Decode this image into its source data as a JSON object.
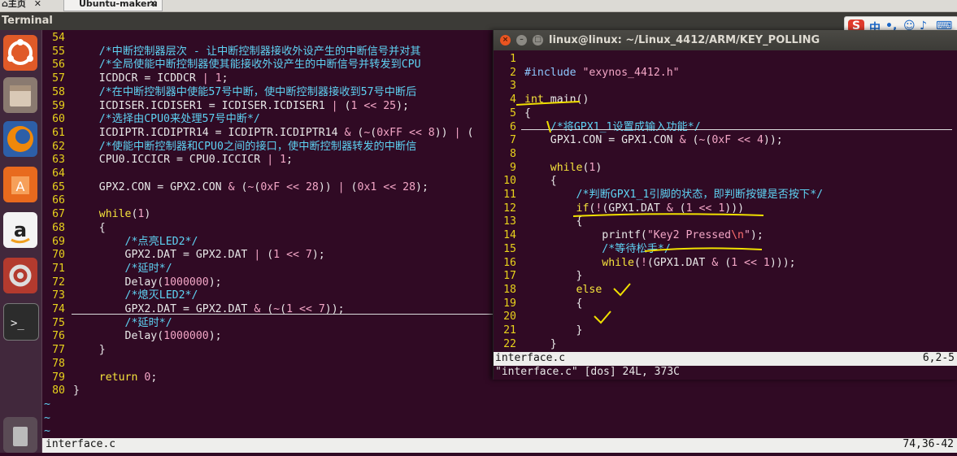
{
  "browser_tabs": {
    "home_label": "主页",
    "home_close": "✕",
    "doc_label": "Ubuntu-makeru",
    "doc_close": "✕"
  },
  "window": {
    "app_title": "Terminal"
  },
  "launcher": {
    "items": [
      "ubuntu-dash",
      "files",
      "firefox",
      "software-center",
      "amazon",
      "system-settings",
      "terminal",
      "trash"
    ]
  },
  "editor": {
    "lines": [
      {
        "n": "54",
        "t": ""
      },
      {
        "n": "55",
        "t": "    /*中断控制器层次 - 让中断控制器接收外设产生的中断信号并对其"
      },
      {
        "n": "56",
        "t": "    /*全局使能中断控制器使其能接收外设产生的中断信号并转发到CPU"
      },
      {
        "n": "57",
        "t": "    ICDDCR = ICDDCR | 1;"
      },
      {
        "n": "58",
        "t": "    /*在中断控制器中使能57号中断，使中断控制器接收到57号中断后"
      },
      {
        "n": "59",
        "t": "    ICDISER.ICDISER1 = ICDISER.ICDISER1 | (1 << 25);"
      },
      {
        "n": "60",
        "t": "    /*选择由CPU0来处理57号中断*/"
      },
      {
        "n": "61",
        "t": "    ICDIPTR.ICDIPTR14 = ICDIPTR.ICDIPTR14 & (~(0xFF << 8)) | ("
      },
      {
        "n": "62",
        "t": "    /*使能中断控制器和CPU0之间的接口，使中断控制器转发的中断信"
      },
      {
        "n": "63",
        "t": "    CPU0.ICCICR = CPU0.ICCICR | 1;"
      },
      {
        "n": "64",
        "t": ""
      },
      {
        "n": "65",
        "t": "    GPX2.CON = GPX2.CON & (~(0xF << 28)) | (0x1 << 28);"
      },
      {
        "n": "66",
        "t": ""
      },
      {
        "n": "67",
        "t": "    while(1)"
      },
      {
        "n": "68",
        "t": "    {"
      },
      {
        "n": "69",
        "t": "        /*点亮LED2*/"
      },
      {
        "n": "70",
        "t": "        GPX2.DAT = GPX2.DAT | (1 << 7);"
      },
      {
        "n": "71",
        "t": "        /*延时*/"
      },
      {
        "n": "72",
        "t": "        Delay(1000000);"
      },
      {
        "n": "73",
        "t": "        /*熄灭LED2*/"
      },
      {
        "n": "74",
        "t": "        GPX2.DAT = GPX2.DAT & (~(1 << 7));"
      },
      {
        "n": "75",
        "t": "        /*延时*/"
      },
      {
        "n": "76",
        "t": "        Delay(1000000);"
      },
      {
        "n": "77",
        "t": "    }"
      },
      {
        "n": "78",
        "t": ""
      },
      {
        "n": "79",
        "t": "    return 0;"
      },
      {
        "n": "80",
        "t": "}"
      }
    ],
    "tildes": [
      "~",
      "~",
      "~"
    ],
    "status_file": "interface.c",
    "status_pos": "74,36-42"
  },
  "window2": {
    "title": "linux@linux: ~/Linux_4412/ARM/KEY_POLLING",
    "lines": [
      {
        "n": "1",
        "t": ""
      },
      {
        "n": "2",
        "t": "#include \"exynos_4412.h\""
      },
      {
        "n": "3",
        "t": ""
      },
      {
        "n": "4",
        "t": "int main()"
      },
      {
        "n": "5",
        "t": "{"
      },
      {
        "n": "6",
        "t": "    /*将GPX1_1设置成输入功能*/"
      },
      {
        "n": "7",
        "t": "    GPX1.CON = GPX1.CON & (~(0xF << 4));"
      },
      {
        "n": "8",
        "t": ""
      },
      {
        "n": "9",
        "t": "    while(1)"
      },
      {
        "n": "10",
        "t": "    {"
      },
      {
        "n": "11",
        "t": "        /*判断GPX1_1引脚的状态，即判断按键是否按下*/"
      },
      {
        "n": "12",
        "t": "        if(!(GPX1.DAT & (1 << 1)))"
      },
      {
        "n": "13",
        "t": "        {"
      },
      {
        "n": "14",
        "t": "            printf(\"Key2 Pressed\\n\");"
      },
      {
        "n": "15",
        "t": "            /*等待松手*/"
      },
      {
        "n": "16",
        "t": "            while(!(GPX1.DAT & (1 << 1)));"
      },
      {
        "n": "17",
        "t": "        }"
      },
      {
        "n": "18",
        "t": "        else"
      },
      {
        "n": "19",
        "t": "        {"
      },
      {
        "n": "20",
        "t": ""
      },
      {
        "n": "21",
        "t": "        }"
      },
      {
        "n": "22",
        "t": "    }"
      }
    ],
    "status_file": "interface.c",
    "status_pos": "6,2-5",
    "message": "\"interface.c\" [dos] 24L, 373C"
  },
  "tray": {
    "ime_label": "中",
    "punct": "•,"
  },
  "colors": {
    "bg": "#300a24",
    "linenum": "#e8d21c",
    "comment": "#5ed2f3",
    "annotation": "#f0e000"
  }
}
